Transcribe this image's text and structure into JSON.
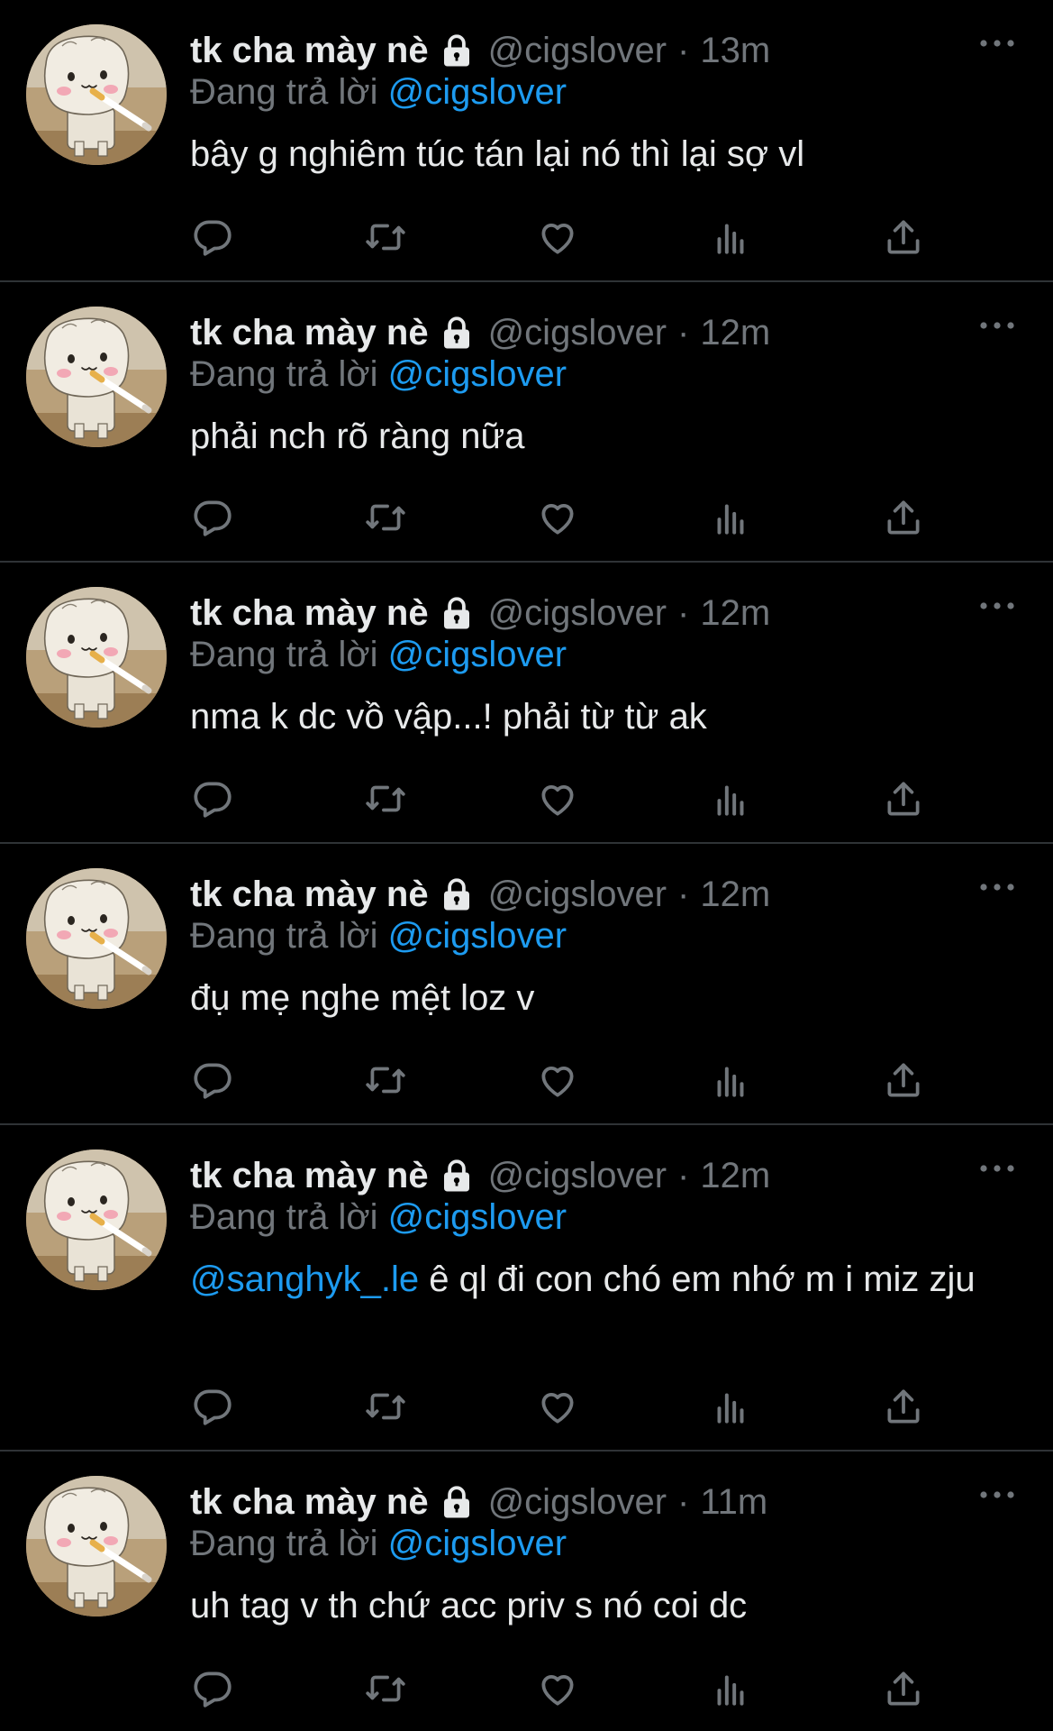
{
  "colors": {
    "background": "#000000",
    "text": "#e7e9ea",
    "muted": "#71767b",
    "link": "#1d9bf0",
    "divider": "#2f3336"
  },
  "tweets": [
    {
      "display_name": "tk cha mày nè",
      "handle": "@cigslover",
      "separator": "·",
      "time": "13m",
      "reply_prefix": "Đang trả lời",
      "reply_to": "@cigslover",
      "mention": "",
      "text": "bây g nghiêm túc tán lại nó thì lại sợ vl",
      "icons": [
        "lock-icon",
        "more-icon",
        "reply-icon",
        "retweet-icon",
        "like-icon",
        "views-icon",
        "share-icon"
      ]
    },
    {
      "display_name": "tk cha mày nè",
      "handle": "@cigslover",
      "separator": "·",
      "time": "12m",
      "reply_prefix": "Đang trả lời",
      "reply_to": "@cigslover",
      "mention": "",
      "text": "phải nch rõ ràng nữa"
    },
    {
      "display_name": "tk cha mày nè",
      "handle": "@cigslover",
      "separator": "·",
      "time": "12m",
      "reply_prefix": "Đang trả lời",
      "reply_to": "@cigslover",
      "mention": "",
      "text": "nma k dc vồ vập...! phải từ từ ak"
    },
    {
      "display_name": "tk cha mày nè",
      "handle": "@cigslover",
      "separator": "·",
      "time": "12m",
      "reply_prefix": "Đang trả lời",
      "reply_to": "@cigslover",
      "mention": "",
      "text": "đụ mẹ nghe mệt loz v"
    },
    {
      "display_name": "tk cha mày nè",
      "handle": "@cigslover",
      "separator": "·",
      "time": "12m",
      "reply_prefix": "Đang trả lời",
      "reply_to": "@cigslover",
      "mention": "@sanghyk_.le",
      "text": " ê ql đi con chó em nhớ m i miz zju"
    },
    {
      "display_name": "tk cha mày nè",
      "handle": "@cigslover",
      "separator": "·",
      "time": "11m",
      "reply_prefix": "Đang trả lời",
      "reply_to": "@cigslover",
      "mention": "",
      "text": "uh tag v th chứ acc priv s nó coi dc"
    }
  ]
}
